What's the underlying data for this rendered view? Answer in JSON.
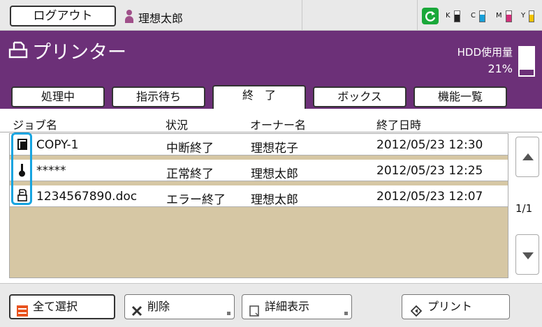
{
  "topbar": {
    "logout_label": "ログアウト",
    "user_name": "理想太郎",
    "toner": [
      {
        "label": "K",
        "color": "#222222",
        "level": 0.7
      },
      {
        "label": "C",
        "color": "#1aa0d8",
        "level": 0.7
      },
      {
        "label": "M",
        "color": "#d2307a",
        "level": 0.7
      },
      {
        "label": "Y",
        "color": "#f3c300",
        "level": 0.7
      }
    ]
  },
  "header": {
    "title": "プリンター",
    "hdd_label": "HDD使用量",
    "hdd_percent": "21%",
    "hdd_level": 0.21
  },
  "tabs": [
    {
      "label": "処理中",
      "active": false
    },
    {
      "label": "指示待ち",
      "active": false
    },
    {
      "label": "終　了",
      "active": true
    },
    {
      "label": "ボックス",
      "active": false
    },
    {
      "label": "機能一覧",
      "active": false
    }
  ],
  "columns": {
    "job_name": "ジョブ名",
    "status": "状況",
    "owner": "オーナー名",
    "end_time": "終了日時"
  },
  "jobs": [
    {
      "icon": "copy-icon",
      "name": "COPY-1",
      "status": "中断終了",
      "owner": "理想花子",
      "end_time": "2012/05/23  12:30"
    },
    {
      "icon": "key-icon",
      "name": "*****",
      "status": "正常終了",
      "owner": "理想太郎",
      "end_time": "2012/05/23  12:25"
    },
    {
      "icon": "print-doc-icon",
      "name": "1234567890.doc",
      "status": "エラー終了",
      "owner": "理想太郎",
      "end_time": "2012/05/23  12:07"
    }
  ],
  "pager": {
    "page": "1/1"
  },
  "bottom": {
    "select_all_label": "全て選択",
    "delete_label": "削除",
    "details_label": "詳細表示",
    "print_label": "プリント"
  },
  "colors": {
    "header_purple": "#6c3078",
    "list_background": "#d6c7a4",
    "highlight_blue": "#17a4e0",
    "select_all_orange": "#e8531f"
  }
}
